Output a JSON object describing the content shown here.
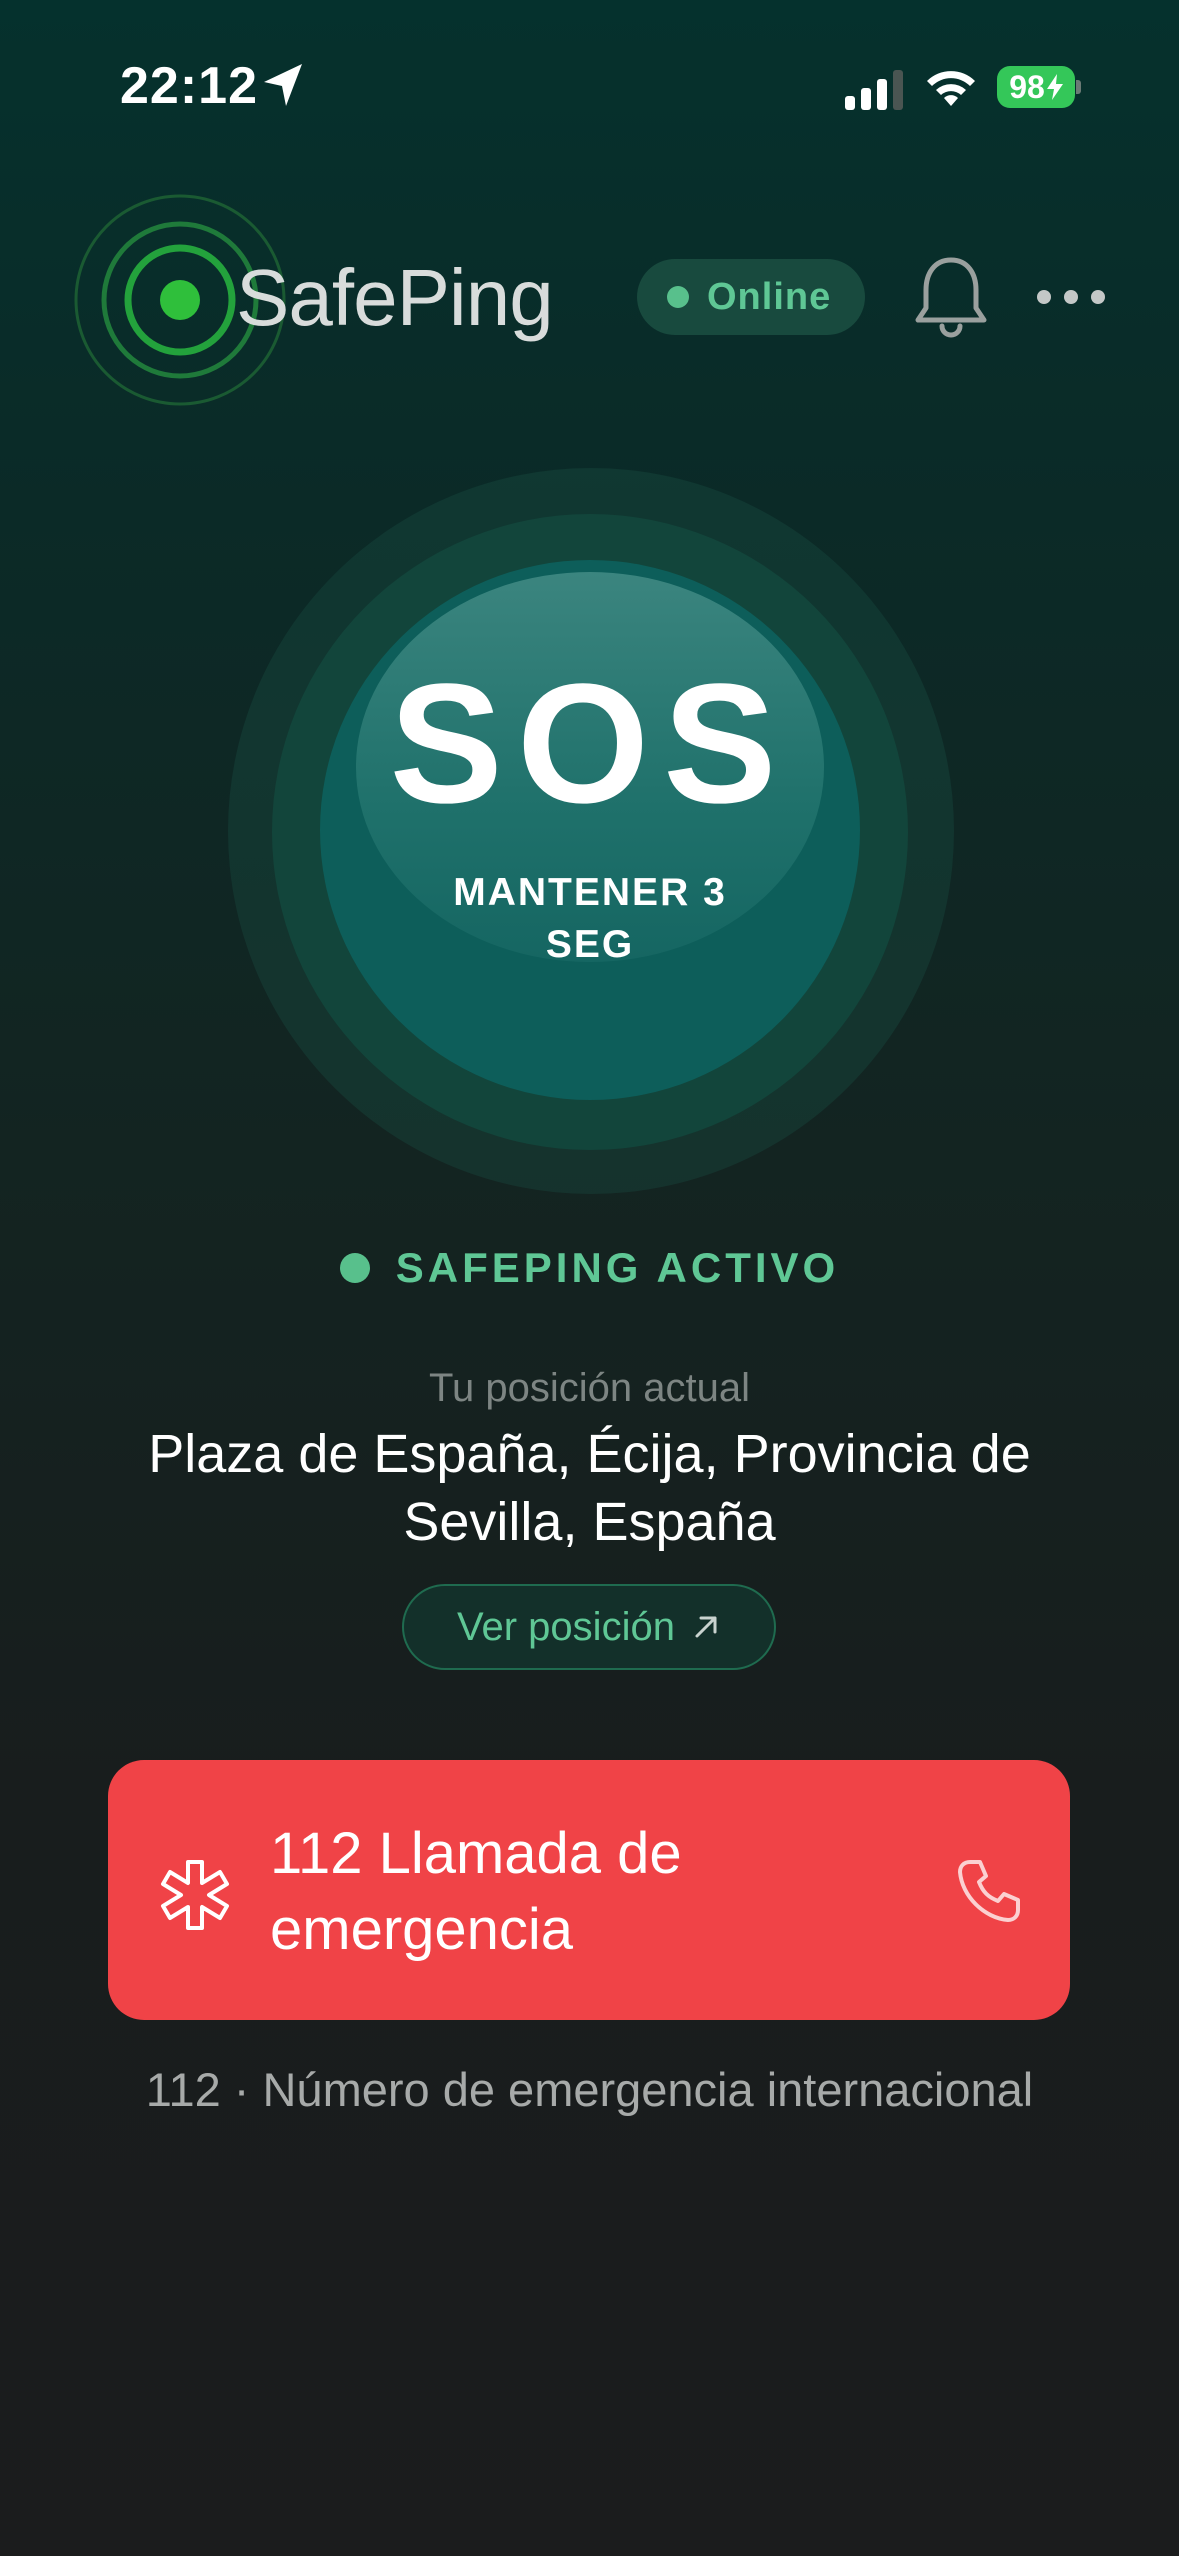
{
  "status_bar": {
    "time": "22:12",
    "battery_percent": "98",
    "icons": [
      "location-arrow-icon",
      "cellular-signal-icon",
      "wifi-icon",
      "battery-charging-icon"
    ]
  },
  "header": {
    "app_name": "SafePing",
    "status_label": "Online",
    "icons": [
      "logo-rings-icon",
      "bell-icon",
      "more-icon"
    ]
  },
  "sos": {
    "label": "SOS",
    "hold_instruction": "MANTENER 3 SEG"
  },
  "status": {
    "active_label": "SAFEPING ACTIVO"
  },
  "location": {
    "caption": "Tu posición actual",
    "address": "Plaza de España, Écija, Provincia de Sevilla, España",
    "view_button_label": "Ver posición",
    "view_button_icon": "external-arrow-icon"
  },
  "emergency": {
    "call_label": "112 Llamada de emergencia",
    "note": "112 · Número de emergencia internacional",
    "icons": [
      "medical-asterisk-icon",
      "phone-icon"
    ]
  },
  "colors": {
    "accent_green": "#5fc795",
    "sos_teal": "#0d5e5a",
    "emergency_red": "#f04347",
    "battery_green": "#34c759"
  }
}
